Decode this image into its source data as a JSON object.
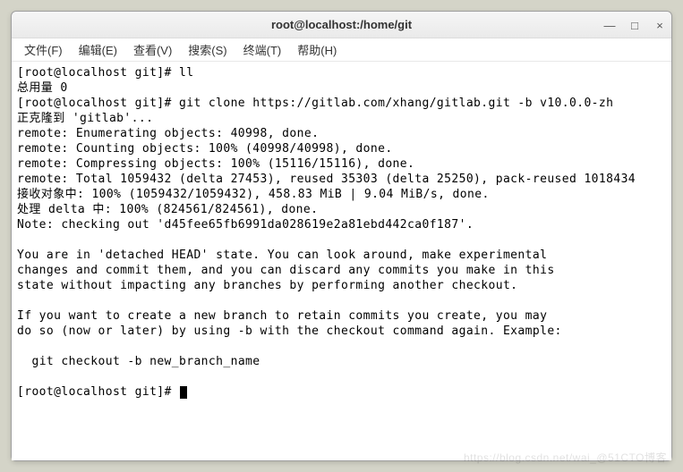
{
  "window": {
    "title": "root@localhost:/home/git",
    "controls": {
      "minimize": "—",
      "maximize": "□",
      "close": "×"
    }
  },
  "menubar": {
    "items": [
      {
        "label": "文件(F)"
      },
      {
        "label": "编辑(E)"
      },
      {
        "label": "查看(V)"
      },
      {
        "label": "搜索(S)"
      },
      {
        "label": "终端(T)"
      },
      {
        "label": "帮助(H)"
      }
    ]
  },
  "terminal": {
    "lines": [
      "[root@localhost git]# ll",
      "总用量 0",
      "[root@localhost git]# git clone https://gitlab.com/xhang/gitlab.git -b v10.0.0-zh",
      "正克隆到 'gitlab'...",
      "remote: Enumerating objects: 40998, done.",
      "remote: Counting objects: 100% (40998/40998), done.",
      "remote: Compressing objects: 100% (15116/15116), done.",
      "remote: Total 1059432 (delta 27453), reused 35303 (delta 25250), pack-reused 1018434",
      "接收对象中: 100% (1059432/1059432), 458.83 MiB | 9.04 MiB/s, done.",
      "处理 delta 中: 100% (824561/824561), done.",
      "Note: checking out 'd45fee65fb6991da028619e2a81ebd442ca0f187'.",
      "",
      "You are in 'detached HEAD' state. You can look around, make experimental",
      "changes and commit them, and you can discard any commits you make in this",
      "state without impacting any branches by performing another checkout.",
      "",
      "If you want to create a new branch to retain commits you create, you may",
      "do so (now or later) by using -b with the checkout command again. Example:",
      "",
      "  git checkout -b new_branch_name",
      ""
    ],
    "prompt": "[root@localhost git]# "
  },
  "watermark": "https://blog.csdn.net/wai_@51CTO博客"
}
